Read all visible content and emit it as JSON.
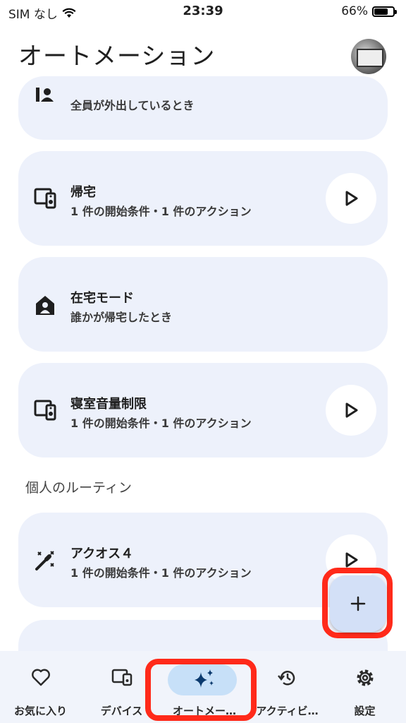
{
  "status_bar": {
    "carrier": "SIM なし",
    "time": "23:39",
    "battery_text": "66%",
    "battery_level": 0.66
  },
  "header": {
    "title": "オートメーション"
  },
  "cards": [
    {
      "title": "",
      "subtitle": "全員が外出しているとき",
      "icon": "person-away-icon",
      "has_play": false
    },
    {
      "title": "帰宅",
      "subtitle": "1 件の開始条件・1 件のアクション",
      "icon": "speaker-device-icon",
      "has_play": true
    },
    {
      "title": "在宅モード",
      "subtitle": "誰かが帰宅したとき",
      "icon": "home-person-icon",
      "has_play": false
    },
    {
      "title": "寝室音量制限",
      "subtitle": "1 件の開始条件・1 件のアクション",
      "icon": "speaker-device-icon",
      "has_play": true
    },
    {
      "title": "アクオス４",
      "subtitle": "1 件の開始条件・1 件のアクション",
      "icon": "magic-wand-icon",
      "has_play": true
    }
  ],
  "section_label": "個人のルーティン",
  "fab": {
    "icon": "plus-icon"
  },
  "bottom_nav": [
    {
      "label": "お気に入り",
      "icon": "heart-icon"
    },
    {
      "label": "デバイス",
      "icon": "devices-icon"
    },
    {
      "label": "オートメー…",
      "icon": "sparkle-icon",
      "active": true
    },
    {
      "label": "アクティビ…",
      "icon": "history-icon"
    },
    {
      "label": "設定",
      "icon": "gear-icon"
    }
  ],
  "colors": {
    "card_bg": "#edf1fb",
    "nav_bg": "#f1f4fb",
    "active_pill": "#c7e0f8",
    "highlight": "#ff2a1a"
  }
}
